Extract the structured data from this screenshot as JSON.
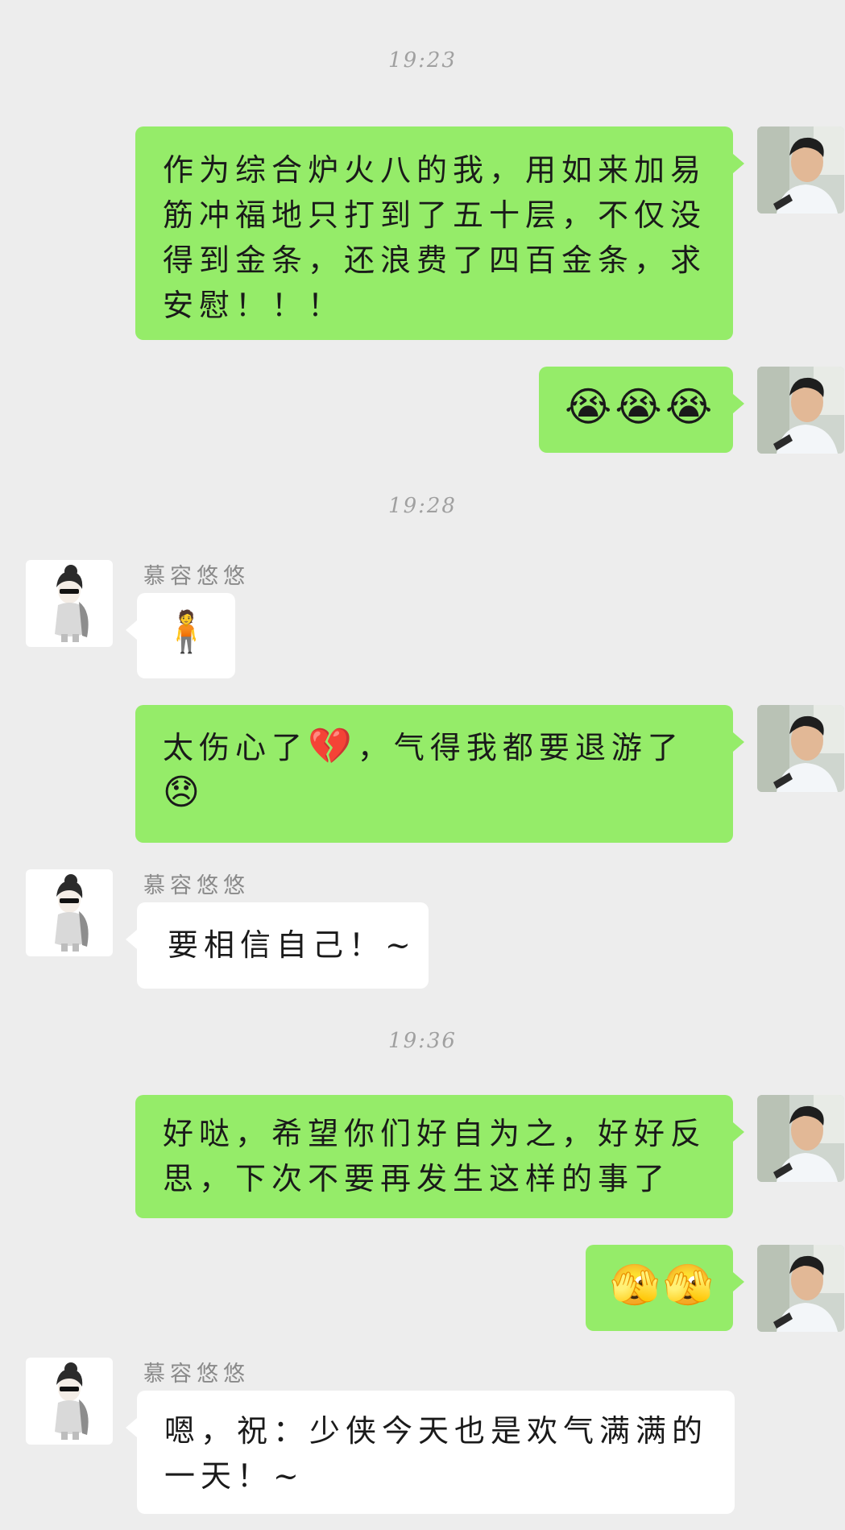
{
  "timestamps": [
    "19:23",
    "19:28",
    "19:36"
  ],
  "contact": {
    "name": "慕容悠悠"
  },
  "messages": [
    {
      "from": "me",
      "text": "作为综合炉火八的我，用如来加易筋冲福地只打到了五十层，不仅没得到金条，还浪费了四百金条，求安慰！！！"
    },
    {
      "from": "me",
      "emoji": "😭😭😭"
    },
    {
      "from": "them",
      "emoji": "🧍"
    },
    {
      "from": "me",
      "text_a": "太伤心了",
      "emoji_a": "💔",
      "text_b": "，气得我都要退游了",
      "emoji_b": "😞"
    },
    {
      "from": "them",
      "text": "要相信自己！~"
    },
    {
      "from": "me",
      "text": "好哒，希望你们好自为之，好好反思，下次不要再发生这样的事了"
    },
    {
      "from": "me",
      "emoji": "🫣🫣"
    },
    {
      "from": "them",
      "text": "嗯，祝：少侠今天也是欢气满满的一天！~"
    }
  ],
  "icons": {
    "my_avatar": "profile-photo-young-man",
    "contact_avatar": "cartoon-girl-sunglasses"
  },
  "colors": {
    "my_bubble": "#95ec69",
    "their_bubble": "#ffffff",
    "background": "#ededed"
  }
}
